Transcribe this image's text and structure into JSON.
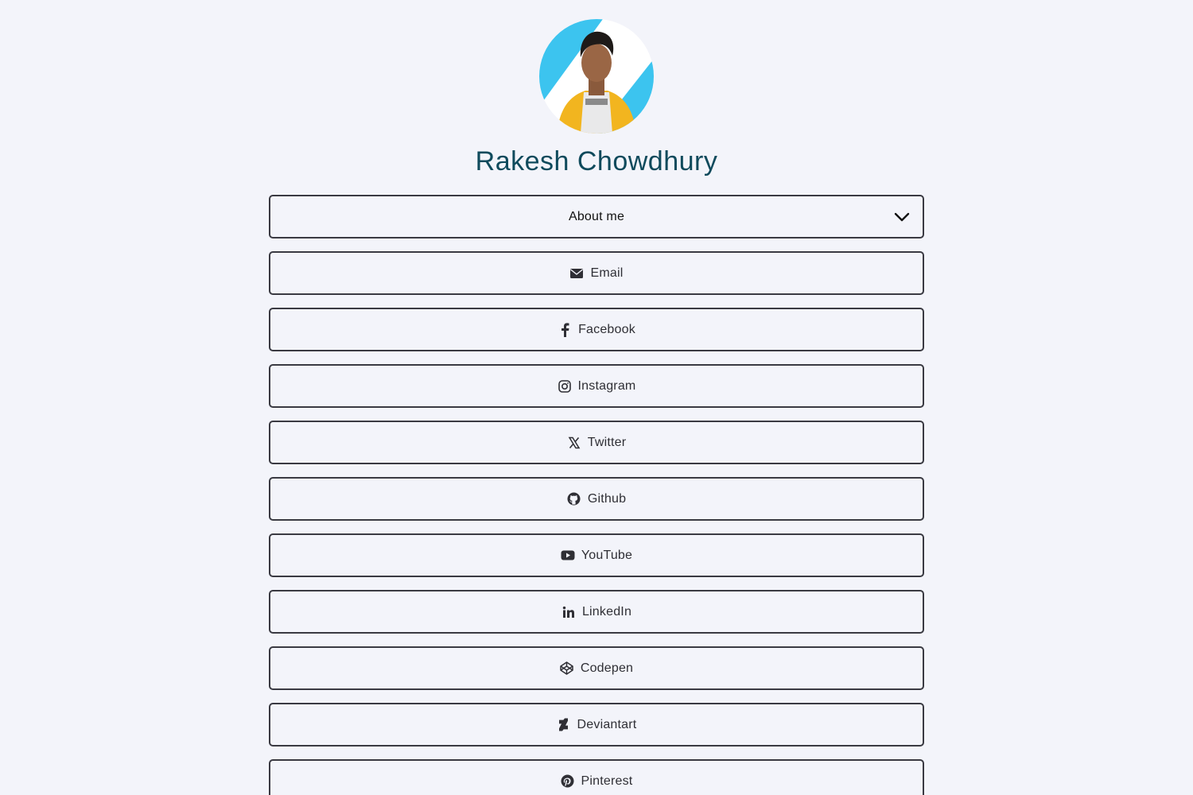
{
  "profile": {
    "name": "Rakesh Chowdhury"
  },
  "about": {
    "label": "About me"
  },
  "links": [
    {
      "label": "Email",
      "icon": "envelope-icon"
    },
    {
      "label": "Facebook",
      "icon": "facebook-icon"
    },
    {
      "label": "Instagram",
      "icon": "instagram-icon"
    },
    {
      "label": "Twitter",
      "icon": "x-icon"
    },
    {
      "label": "Github",
      "icon": "github-icon"
    },
    {
      "label": "YouTube",
      "icon": "youtube-icon"
    },
    {
      "label": "LinkedIn",
      "icon": "linkedin-icon"
    },
    {
      "label": "Codepen",
      "icon": "codepen-icon"
    },
    {
      "label": "Deviantart",
      "icon": "deviantart-icon"
    },
    {
      "label": "Pinterest",
      "icon": "pinterest-icon"
    }
  ],
  "colors": {
    "background": "#f3f4fa",
    "name": "#0f4a5c",
    "border": "#3a3a42",
    "avatar_accent": "#3cc4ef"
  }
}
